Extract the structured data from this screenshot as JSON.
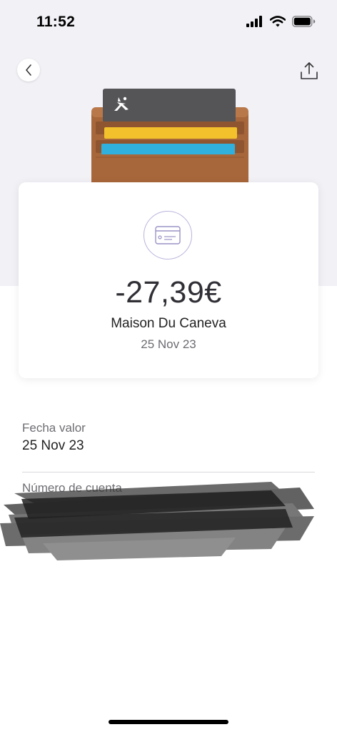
{
  "status_bar": {
    "time": "11:52",
    "icons": [
      "cellular-signal-icon",
      "wifi-icon",
      "battery-icon"
    ]
  },
  "header": {
    "back_icon": "chevron-left-icon",
    "share_icon": "share-icon"
  },
  "wallet_illustration": {
    "logo_icon": "caixabank-star-logo",
    "colors": {
      "leather": "#a8673a",
      "card_dark": "#555558",
      "card_yellow": "#f2c12c",
      "card_blue": "#2fb0dd"
    }
  },
  "transaction": {
    "icon": "credit-card-icon",
    "amount": "-27,39€",
    "merchant": "Maison Du Caneva",
    "date": "25 Nov 23"
  },
  "details": {
    "value_date_label": "Fecha valor",
    "value_date": "25 Nov 23",
    "account_number_label": "Número de cuenta"
  },
  "colors": {
    "accent_lavender": "#b9b2dc",
    "header_bg": "#f1f1f6"
  }
}
